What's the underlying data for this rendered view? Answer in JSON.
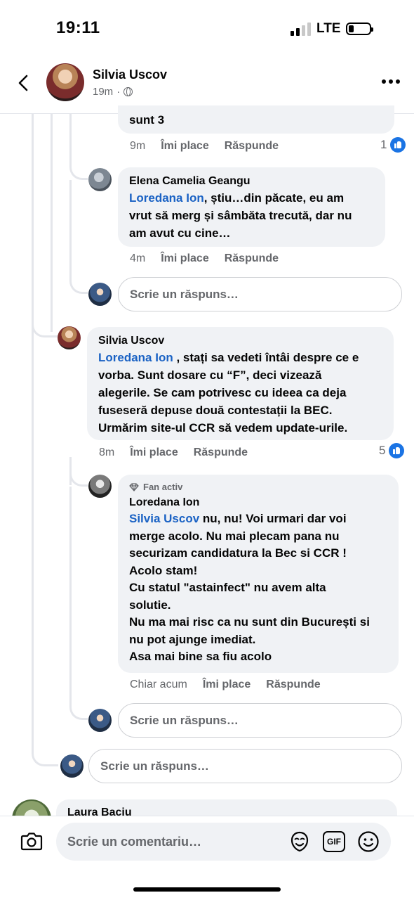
{
  "status_bar": {
    "time": "19:11",
    "network": "LTE"
  },
  "header": {
    "name": "Silvia Uscov",
    "time": "19m",
    "separator": "·",
    "back_icon": "chevron-left-icon",
    "privacy_icon": "globe-icon",
    "more_icon": "more-dots-icon"
  },
  "comments": [
    {
      "text_tail": "sunt 3",
      "time": "9m",
      "like_label": "Îmi place",
      "reply_label": "Răspunde",
      "like_count": "1"
    },
    {
      "name": "Elena Camelia Geangu",
      "mention": "Loredana Ion",
      "text": ", știu…din păcate, eu am\nvrut să merg și sâmbăta trecută, dar nu\nam avut cu cine…",
      "time": "4m",
      "like_label": "Îmi place",
      "reply_label": "Răspunde"
    },
    {
      "name": "Silvia Uscov",
      "mention": "Loredana Ion",
      "text": " , stați sa vedeti întâi despre ce e\nvorba. Sunt dosare cu “F”, deci vizează\nalegerile. Se cam potrivesc cu ideea ca deja\nfuseseră depuse două contestații la BEC.\nUrmărim site-ul CCR să vedem update-urile.",
      "time": "8m",
      "like_label": "Îmi place",
      "reply_label": "Răspunde",
      "like_count": "5"
    },
    {
      "badge": "Fan activ",
      "name": "Loredana Ion",
      "mention": "Silvia Uscov",
      "text": " nu, nu! Voi urmari dar voi\nmerge acolo. Nu mai plecam pana nu\nsecurizam candidatura la Bec si CCR !\nAcolo stam!\nCu statul \"astainfect\" nu avem alta\nsolutie.\nNu ma mai risc ca nu sunt din București si\nnu pot ajunge imediat.\nAsa mai bine sa fiu acolo",
      "time": "Chiar acum",
      "like_label": "Îmi place",
      "reply_label": "Răspunde"
    },
    {
      "name": "Laura Baciu"
    }
  ],
  "reply_placeholder": "Scrie un răspuns…",
  "bottom_bar": {
    "placeholder": "Scrie un comentariu…",
    "gif_label": "GIF",
    "camera_icon": "camera-icon",
    "avatar_sticker_icon": "avatar-sticker-icon",
    "emoji_icon": "emoji-icon"
  },
  "colors": {
    "mention": "#1a62c4",
    "like": "#1b74e4",
    "bubble": "#f0f2f5",
    "secondary": "#65676b"
  }
}
